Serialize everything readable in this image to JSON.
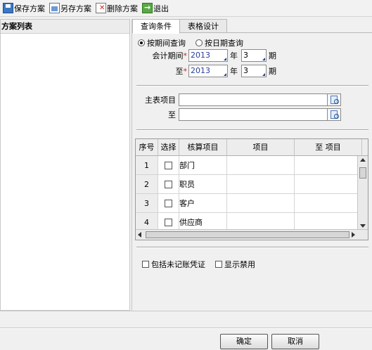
{
  "toolbar": {
    "save": "保存方案",
    "save_as": "另存方案",
    "delete": "删除方案",
    "exit": "退出"
  },
  "left": {
    "title": "方案列表"
  },
  "tabs": [
    "查询条件",
    "表格设计"
  ],
  "radios": {
    "by_period": "按期间查询",
    "by_date": "按日期查询",
    "selected": "by_period"
  },
  "period": {
    "label_from": "会计期间",
    "label_to": "至",
    "year_from": "2013",
    "month_from": "3",
    "year_to": "2013",
    "month_to": "3",
    "unit_year": "年",
    "unit_period": "期"
  },
  "refs": {
    "main_label": "主表项目",
    "to_label": "至",
    "main_value": "",
    "to_value": ""
  },
  "grid": {
    "headers": [
      "序号",
      "选择",
      "核算项目",
      "项目",
      "至 项目"
    ],
    "rows": [
      {
        "no": "1",
        "name": "部门"
      },
      {
        "no": "2",
        "name": "职员"
      },
      {
        "no": "3",
        "name": "客户"
      },
      {
        "no": "4",
        "name": "供应商"
      }
    ]
  },
  "options": {
    "include_unposted": "包括未记账凭证",
    "show_disabled": "显示禁用"
  },
  "buttons": {
    "ok": "确定",
    "cancel": "取消"
  }
}
